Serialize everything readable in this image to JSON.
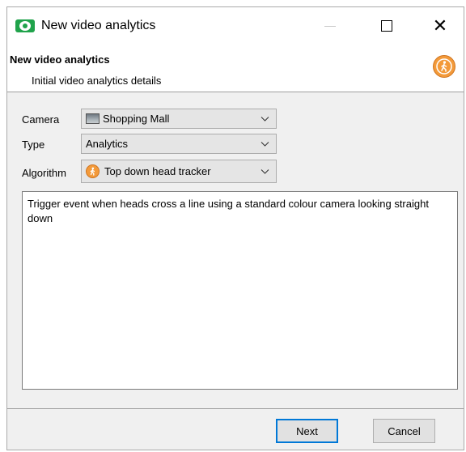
{
  "window": {
    "title": "New video analytics",
    "icon": "eye-app-icon"
  },
  "header": {
    "title": "New video analytics",
    "subtitle": "Initial video analytics details",
    "icon": "walking-person-icon"
  },
  "form": {
    "camera": {
      "label": "Camera",
      "value": "Shopping Mall",
      "icon": "camera-thumbnail-icon"
    },
    "type": {
      "label": "Type",
      "value": "Analytics"
    },
    "algorithm": {
      "label": "Algorithm",
      "value": "Top down head tracker",
      "icon": "walking-person-icon"
    }
  },
  "description": "Trigger event when heads cross a line using a standard colour camera looking straight down",
  "buttons": {
    "next": "Next",
    "cancel": "Cancel"
  },
  "colors": {
    "accent": "#0078d7",
    "app_icon": "#20a34b",
    "algo_icon": "#f39a3a"
  }
}
